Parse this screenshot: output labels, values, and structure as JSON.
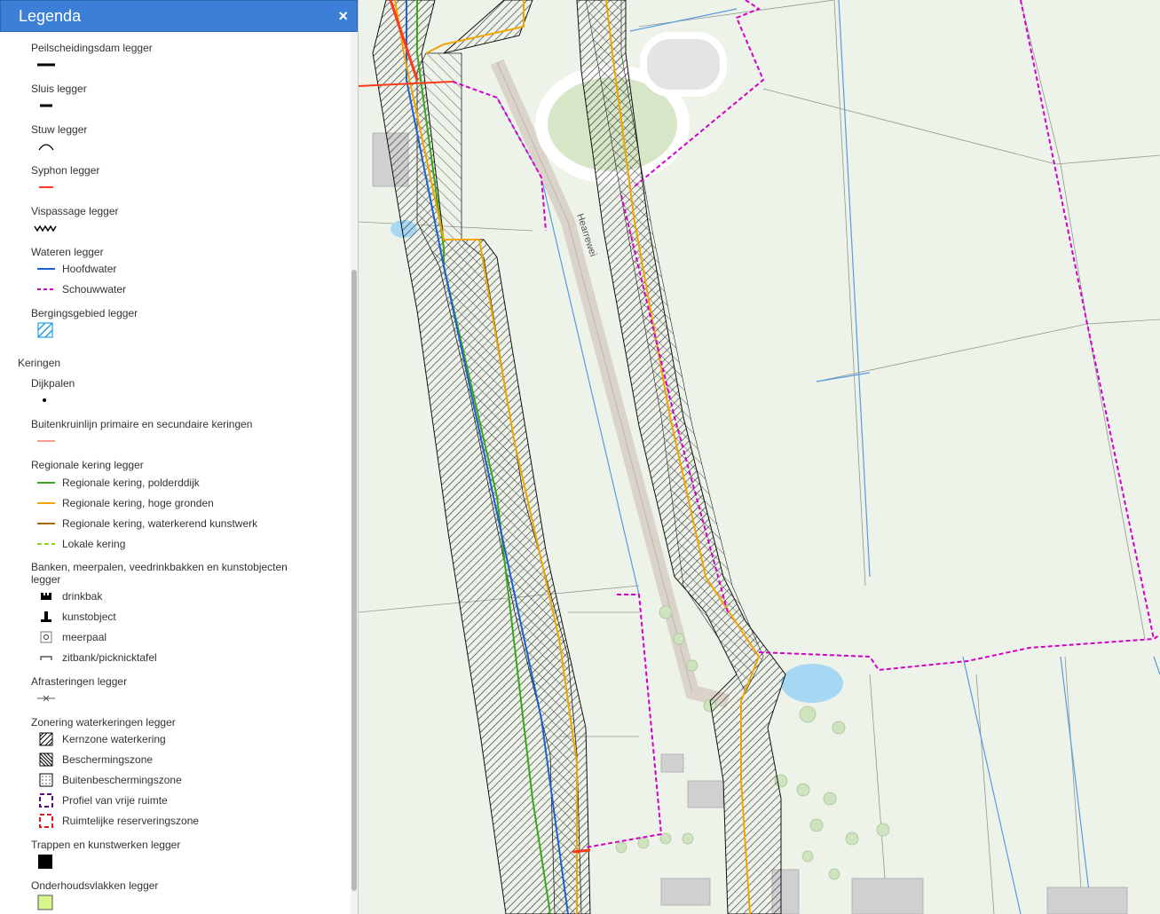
{
  "legend": {
    "title": "Legenda",
    "close_glyph": "×",
    "sections": {
      "peilscheidingsdam": "Peilscheidingsdam legger",
      "sluis": "Sluis legger",
      "stuw": "Stuw legger",
      "syphon": "Syphon legger",
      "vispassage": "Vispassage legger",
      "wateren": "Wateren legger",
      "wateren_items": [
        "Hoofdwater",
        "Schouwwater"
      ],
      "bergingsgebied": "Bergingsgebied legger",
      "keringen_group": "Keringen",
      "dijkpalen": "Dijkpalen",
      "buitenkruinlijn": "Buitenkruinlijn primaire en secundaire keringen",
      "regionale": "Regionale kering legger",
      "regionale_items": [
        "Regionale kering, polderddijk",
        "Regionale kering, hoge gronden",
        "Regionale kering, waterkerend kunstwerk",
        "Lokale kering"
      ],
      "banken": "Banken, meerpalen, veedrinkbakken en kunstobjecten legger",
      "banken_items": [
        "drinkbak",
        "kunstobject",
        "meerpaal",
        "zitbank/picknicktafel"
      ],
      "afrasteringen": "Afrasteringen legger",
      "zonering": "Zonering waterkeringen legger",
      "zonering_items": [
        "Kernzone waterkering",
        "Beschermingszone",
        "Buitenbeschermingszone",
        "Profiel van vrije ruimte",
        "Ruimtelijke reserveringszone"
      ],
      "trappen": "Trappen en kunstwerken legger",
      "onderhoud": "Onderhoudsvlakken legger"
    }
  },
  "map": {
    "road_label": "Hearrewei"
  },
  "colors": {
    "header_blue": "#3b7fd6",
    "hoofdwater": "#1f5fd0",
    "schouwwater": "#d400c8",
    "polderdijk": "#3aa61b",
    "hoge_gronden": "#f2a500",
    "waterkerend_kunstwerk": "#a86a00",
    "lokale_kering": "#8ad21b",
    "syphon": "#ff3a1a",
    "onderhoud": "#d8f58a"
  }
}
